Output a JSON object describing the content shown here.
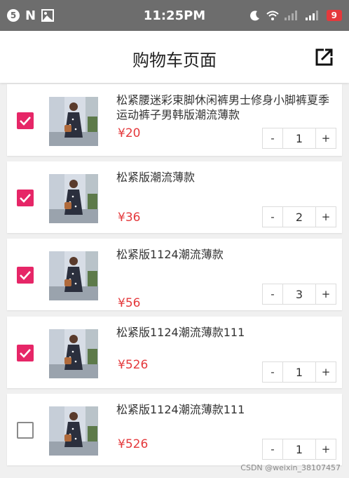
{
  "status_bar": {
    "notification_count": "5",
    "app_letter": "N",
    "time": "11:25PM",
    "battery": "9",
    "battery_color": "#e4393c"
  },
  "header": {
    "title": "购物车页面",
    "edit_icon": "external-edit-icon"
  },
  "colors": {
    "accent": "#e62667",
    "price": "#e4393c"
  },
  "cart_items": [
    {
      "title": "松紧腰迷彩束脚休闲裤男士修身小脚裤夏季运动裤子男韩版潮流薄款",
      "price": "¥20",
      "quantity": "1",
      "checked": true
    },
    {
      "title": "松紧版潮流薄款",
      "price": "¥36",
      "quantity": "2",
      "checked": true
    },
    {
      "title": "松紧版1124潮流薄款",
      "price": "¥56",
      "quantity": "3",
      "checked": true
    },
    {
      "title": "松紧版1124潮流薄款111",
      "price": "¥526",
      "quantity": "1",
      "checked": true
    },
    {
      "title": "松紧版1124潮流薄款111",
      "price": "¥526",
      "quantity": "1",
      "checked": false
    }
  ],
  "stepper": {
    "minus": "-",
    "plus": "+"
  },
  "watermark": "CSDN @weixin_38107457"
}
